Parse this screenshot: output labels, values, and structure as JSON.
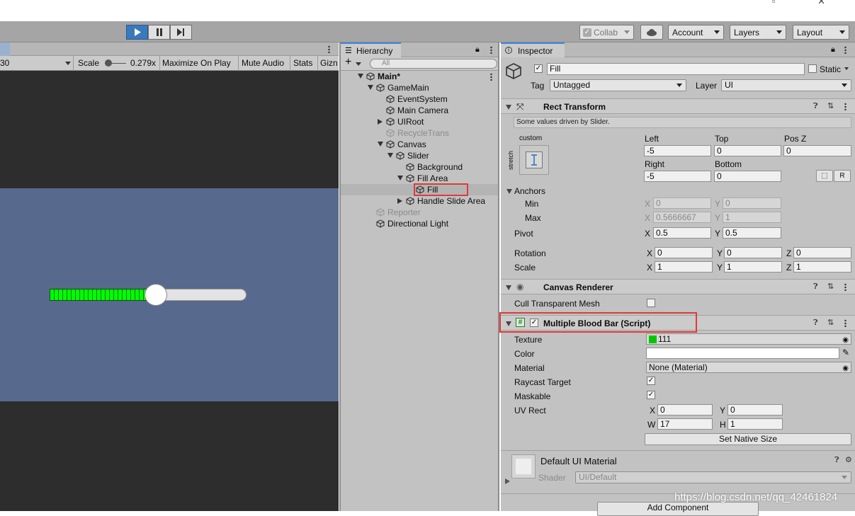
{
  "window": {
    "controls": "▫ ✕"
  },
  "toolbar": {
    "collab": "Collab",
    "account": "Account",
    "layers": "Layers",
    "layout": "Layout",
    "play_icon": "play-icon",
    "pause_icon": "pause-icon",
    "step_icon": "step-icon"
  },
  "game_view": {
    "resolution": "30",
    "scale_label": "Scale",
    "scale_value": "0.279x",
    "maximize": "Maximize On Play",
    "mute": "Mute Audio",
    "stats": "Stats",
    "gizmos": "Gizn",
    "slider": {
      "fill_fraction": 0.54,
      "fill_color": "#00ff00",
      "background_color": "#58698e"
    }
  },
  "hierarchy": {
    "tab": "Hierarchy",
    "search_placeholder": "All",
    "items": [
      {
        "label": "Main*",
        "depth": 0,
        "arrow": "down",
        "bold": true
      },
      {
        "label": "GameMain",
        "depth": 1,
        "arrow": "down"
      },
      {
        "label": "EventSystem",
        "depth": 2,
        "arrow": ""
      },
      {
        "label": "Main Camera",
        "depth": 2,
        "arrow": ""
      },
      {
        "label": "UIRoot",
        "depth": 2,
        "arrow": "right"
      },
      {
        "label": "RecycleTrans",
        "depth": 2,
        "arrow": "",
        "grey": true
      },
      {
        "label": "Canvas",
        "depth": 2,
        "arrow": "down"
      },
      {
        "label": "Slider",
        "depth": 3,
        "arrow": "down"
      },
      {
        "label": "Background",
        "depth": 4,
        "arrow": ""
      },
      {
        "label": "Fill Area",
        "depth": 4,
        "arrow": "down"
      },
      {
        "label": "Fill",
        "depth": 5,
        "arrow": "",
        "selected": true
      },
      {
        "label": "Handle Slide Area",
        "depth": 4,
        "arrow": "right"
      },
      {
        "label": "Reporter",
        "depth": 1,
        "arrow": "",
        "grey": true
      },
      {
        "label": "Directional Light",
        "depth": 1,
        "arrow": ""
      }
    ]
  },
  "inspector": {
    "tab": "Inspector",
    "name": "Fill",
    "static": "Static",
    "tag_label": "Tag",
    "tag_value": "Untagged",
    "layer_label": "Layer",
    "layer_value": "UI",
    "rect": {
      "title": "Rect Transform",
      "note": "Some values driven by Slider.",
      "anchor_preset": "custom",
      "stretch": "stretch",
      "left_label": "Left",
      "left": "-5",
      "top_label": "Top",
      "top": "0",
      "posz_label": "Pos Z",
      "posz": "0",
      "right_label": "Right",
      "right": "-5",
      "bottom_label": "Bottom",
      "bottom": "0",
      "r_btn": "R",
      "anchors": "Anchors",
      "min": "Min",
      "max": "Max",
      "min_x": "0",
      "min_y": "0",
      "max_x": "0.5666667",
      "max_y": "1",
      "pivot": "Pivot",
      "pivot_x": "0.5",
      "pivot_y": "0.5",
      "rotation": "Rotation",
      "rot_x": "0",
      "rot_y": "0",
      "rot_z": "0",
      "scale": "Scale",
      "scale_x": "1",
      "scale_y": "1",
      "scale_z": "1",
      "x": "X",
      "y": "Y",
      "z": "Z"
    },
    "canvas_renderer": {
      "title": "Canvas Renderer",
      "cull": "Cull Transparent Mesh"
    },
    "script": {
      "title": "Multiple Blood Bar (Script)",
      "texture_label": "Texture",
      "texture": "111",
      "color_label": "Color",
      "color": "#ffffff",
      "material_label": "Material",
      "material": "None (Material)",
      "raycast": "Raycast Target",
      "maskable": "Maskable",
      "uvrect": "UV Rect",
      "uv_x": "0",
      "uv_y": "0",
      "uv_w": "17",
      "uv_h": "1",
      "w": "W",
      "h": "H",
      "native": "Set Native Size"
    },
    "material": {
      "title": "Default UI Material",
      "shader_label": "Shader",
      "shader": "UI/Default"
    },
    "add_component": "Add Component"
  },
  "watermark": "https://blog.csdn.net/qq_42461824"
}
